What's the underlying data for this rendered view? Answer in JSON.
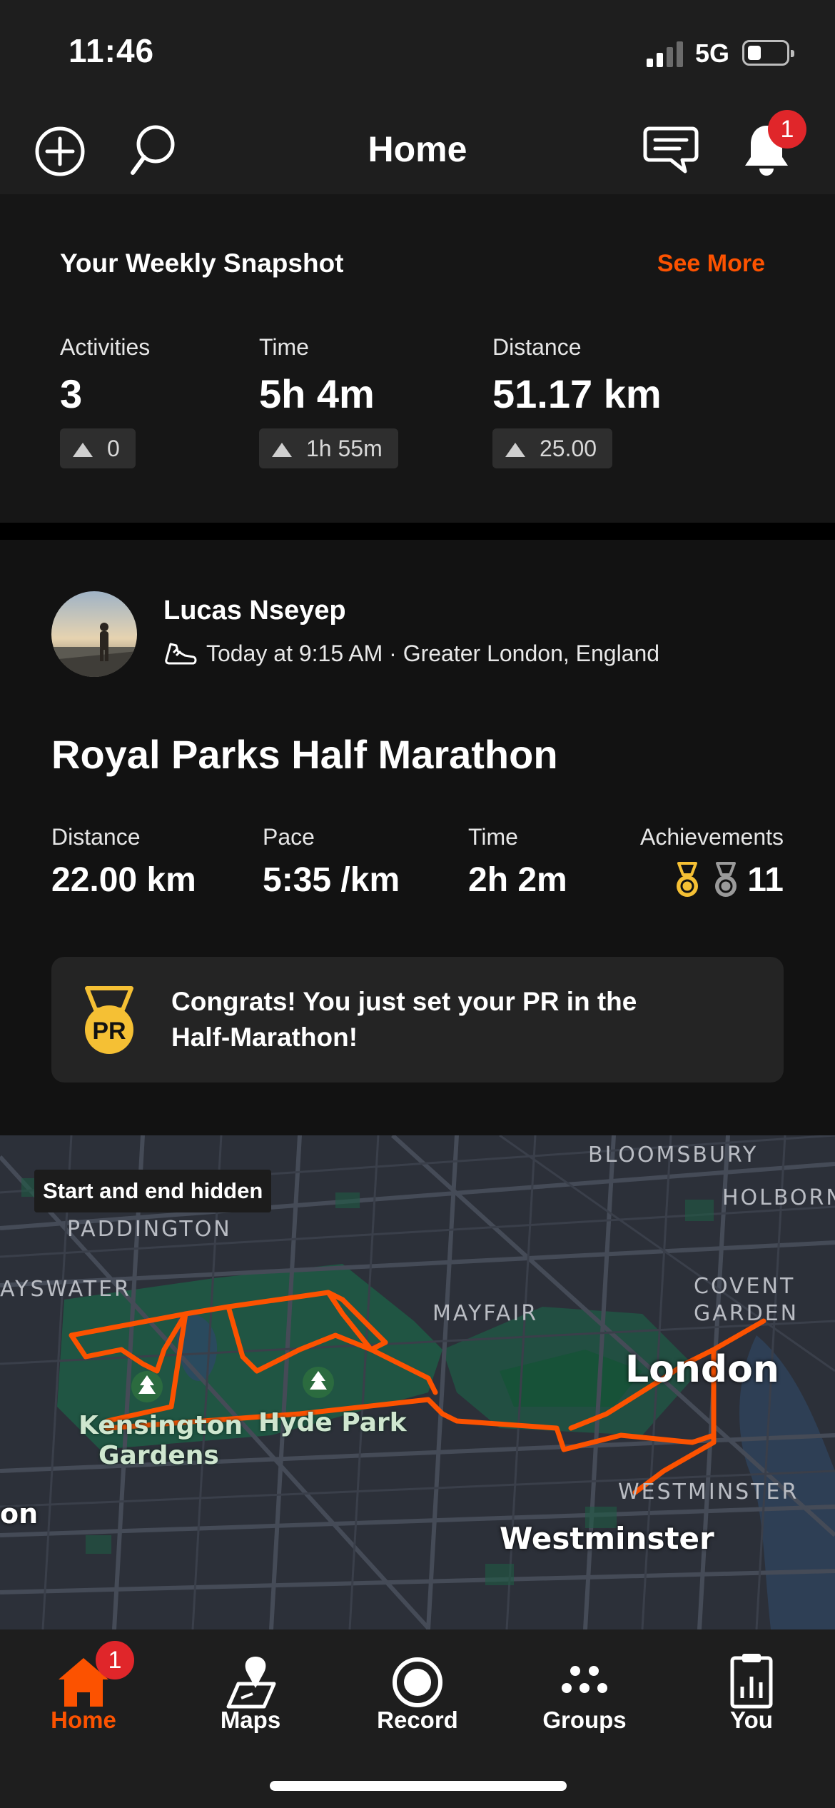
{
  "status_bar": {
    "time": "11:46",
    "network": "5G"
  },
  "header": {
    "title": "Home",
    "notification_count": "1"
  },
  "weekly_snapshot": {
    "title": "Your Weekly Snapshot",
    "see_more": "See More",
    "stats": [
      {
        "label": "Activities",
        "value": "3",
        "delta": "0"
      },
      {
        "label": "Time",
        "value": "5h 4m",
        "delta": "1h 55m"
      },
      {
        "label": "Distance",
        "value": "51.17 km",
        "delta": "25.00"
      }
    ]
  },
  "activity": {
    "athlete": "Lucas Nseyep",
    "meta": "Today at 9:15 AM · Greater London, England",
    "title": "Royal Parks Half Marathon",
    "stats": [
      {
        "label": "Distance",
        "value": "22.00 km"
      },
      {
        "label": "Pace",
        "value": "5:35 /km"
      },
      {
        "label": "Time",
        "value": "2h 2m"
      },
      {
        "label": "Achievements",
        "value": "11"
      }
    ],
    "pr_badge": "PR",
    "pr_message": "Congrats! You just set your PR in the Half-Marathon!"
  },
  "map": {
    "tag": "Start and end hidden",
    "labels": {
      "bloomsbury": "BLOOMSBURY",
      "paddington": "PADDINGTON",
      "holborn": "HOLBORN",
      "bayswater": "AYSWATER",
      "mayfair": "MAYFAIR",
      "covent1": "COVENT",
      "covent2": "GARDEN",
      "london": "London",
      "kensington1": "Kensington",
      "kensington2": "Gardens",
      "hyde_park": "Hyde Park",
      "westminster_caps": "WESTMINSTER",
      "westminster": "Westminster",
      "edge": "on"
    },
    "route_color": "#fc5200"
  },
  "tabs": [
    {
      "label": "Home",
      "badge": "1",
      "active": true
    },
    {
      "label": "Maps"
    },
    {
      "label": "Record"
    },
    {
      "label": "Groups"
    },
    {
      "label": "You"
    }
  ],
  "colors": {
    "accent": "#fc5200",
    "badge": "#e0262a",
    "gold": "#f5c034",
    "silver": "#9a9a9a"
  }
}
